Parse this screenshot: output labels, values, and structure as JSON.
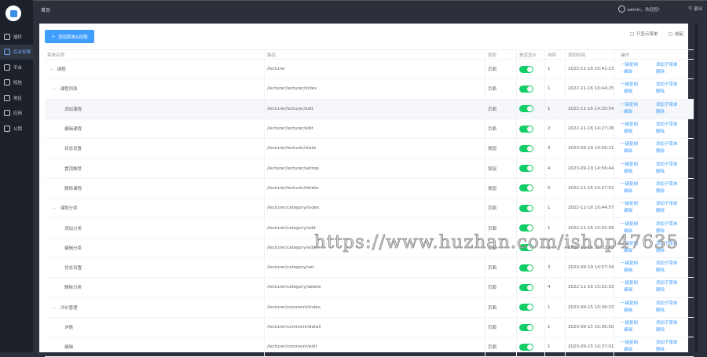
{
  "topbar": {
    "breadcrumb": "首页",
    "user": "admin，欢迎您!",
    "logout": "退出"
  },
  "sidebar": {
    "items": [
      {
        "label": "插件",
        "icon": "puzzle-icon"
      },
      {
        "label": "后台权限",
        "icon": "shield-icon",
        "active": true
      },
      {
        "label": "平台",
        "icon": "home-icon"
      },
      {
        "label": "短信",
        "icon": "mail-icon"
      },
      {
        "label": "地区",
        "icon": "location-icon"
      },
      {
        "label": "应用",
        "icon": "gear-icon"
      },
      {
        "label": "公钥",
        "icon": "key-icon"
      }
    ]
  },
  "toolbar": {
    "add_label": "添加菜单&权限",
    "only_menu": "只显示菜单",
    "collapse": "收起"
  },
  "table": {
    "headers": [
      "菜单名称",
      "路径",
      "类型",
      "是否显示",
      "排序",
      "添加时间",
      "操作"
    ],
    "ops": [
      "一键复制",
      "添加子菜单",
      "编辑",
      "删除"
    ],
    "rows": [
      {
        "name": "课程",
        "level": 0,
        "expand": true,
        "path": "/lecturer",
        "type": "页面",
        "show": true,
        "sort": "1",
        "time": "2022-11-16 10:41:23"
      },
      {
        "name": "课程列表",
        "level": 1,
        "expand": true,
        "path": "/lecturer/lecturer/index",
        "type": "页面",
        "show": true,
        "sort": "1",
        "time": "2022-11-16 10:44:25"
      },
      {
        "name": "添加课程",
        "level": 2,
        "path": "/lecturer/lecturer/add",
        "type": "页面",
        "show": true,
        "sort": "1",
        "time": "2022-11-16 14:20:54",
        "hover": true
      },
      {
        "name": "编辑课程",
        "level": 2,
        "path": "/lecturer/lecturer/edit",
        "type": "页面",
        "show": true,
        "sort": "2",
        "time": "2022-11-16 14:27:26"
      },
      {
        "name": "状态设置",
        "level": 2,
        "path": "/lecturer/lecturer/state",
        "type": "按钮",
        "show": true,
        "sort": "3",
        "time": "2023-09-19 14:56:21"
      },
      {
        "name": "置顶推荐",
        "level": 2,
        "path": "/lecturer/lecturer/settop",
        "type": "按钮",
        "show": true,
        "sort": "4",
        "time": "2023-09-19 14:56:44"
      },
      {
        "name": "删除课程",
        "level": 2,
        "path": "/lecturer/lecturer/delete",
        "type": "按钮",
        "show": true,
        "sort": "5",
        "time": "2022-11-16 14:27:52"
      },
      {
        "name": "课程分类",
        "level": 1,
        "expand": true,
        "path": "/lecturer/category/index",
        "type": "页面",
        "show": true,
        "sort": "1",
        "time": "2022-11-16 10:44:57"
      },
      {
        "name": "添加分类",
        "level": 2,
        "path": "/lecturer/category/add",
        "type": "页面",
        "show": true,
        "sort": "1",
        "time": "2022-11-16 15:02:09"
      },
      {
        "name": "编辑分类",
        "level": 2,
        "path": "/lecturer/category/edit",
        "type": "页面",
        "show": true,
        "sort": "2",
        "time": "2022-11-16 15:02:22"
      },
      {
        "name": "状态设置",
        "level": 2,
        "path": "/lecturer/category/set",
        "type": "页面",
        "show": true,
        "sort": "3",
        "time": "2023-09-19 14:57:34"
      },
      {
        "name": "删除分类",
        "level": 2,
        "path": "/lecturer/category/delete",
        "type": "页面",
        "show": true,
        "sort": "4",
        "time": "2022-11-16 15:02:33"
      },
      {
        "name": "评价管理",
        "level": 1,
        "expand": true,
        "path": "/lecturer/comment/index",
        "type": "页面",
        "show": true,
        "sort": "1",
        "time": "2023-09-15 10:36:23"
      },
      {
        "name": "详情",
        "level": 2,
        "path": "/lecturer/comment/detail",
        "type": "页面",
        "show": true,
        "sort": "1",
        "time": "2023-09-15 10:36:50"
      },
      {
        "name": "编辑",
        "level": 2,
        "path": "/lecturer/comment/edit",
        "type": "页面",
        "show": true,
        "sort": "1",
        "time": "2023-09-15 10:37:01"
      }
    ]
  },
  "watermark": "https://www.huzhan.com/ishop47635",
  "colors": {
    "primary": "#409eff",
    "switch_on": "#13ce66",
    "sidebar": "#1c2029"
  }
}
